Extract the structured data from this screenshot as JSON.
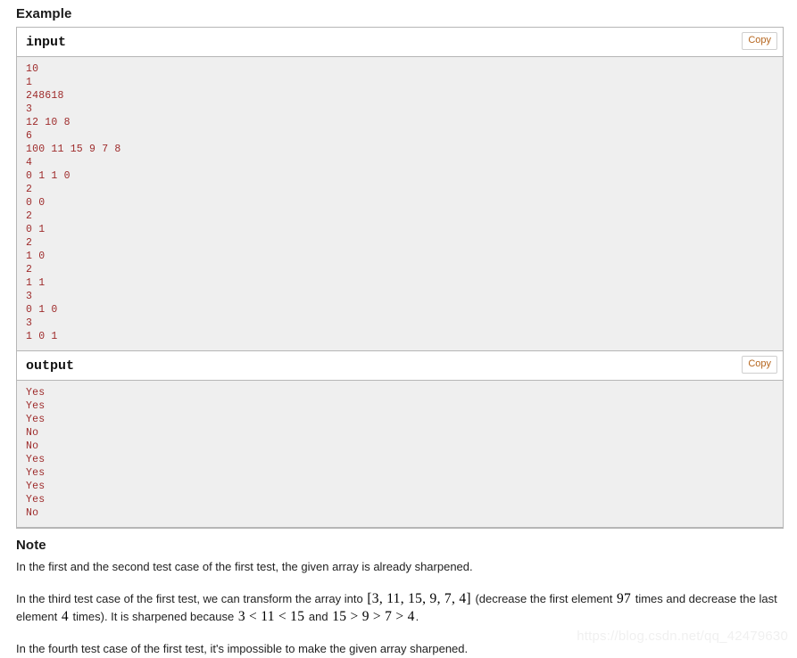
{
  "example": {
    "heading": "Example",
    "blocks": [
      {
        "title": "input",
        "copy_label": "Copy",
        "content": "10\n1\n248618\n3\n12 10 8\n6\n100 11 15 9 7 8\n4\n0 1 1 0\n2\n0 0\n2\n0 1\n2\n1 0\n2\n1 1\n3\n0 1 0\n3\n1 0 1"
      },
      {
        "title": "output",
        "copy_label": "Copy",
        "content": "Yes\nYes\nYes\nNo\nNo\nYes\nYes\nYes\nYes\nNo"
      }
    ]
  },
  "note": {
    "heading": "Note",
    "para1": "In the first and the second test case of the first test, the given array is already sharpened.",
    "para2": {
      "t1": "In the third test case of the first test, we can transform the array into ",
      "m1": "[3, 11, 15, 9, 7, 4]",
      "t2": " (decrease the first element ",
      "m2": "97",
      "t3": " times and decrease the last element ",
      "m3": "4",
      "t4": " times). It is sharpened because ",
      "m4": "3 < 11 < 15",
      "t5": " and ",
      "m5": "15 > 9 > 7 > 4",
      "t6": "."
    },
    "para3": "In the fourth test case of the first test, it's impossible to make the given array sharpened."
  },
  "watermark": "https://blog.csdn.net/qq_42479630",
  "colors": {
    "sample_text": "#9e2b2b",
    "sample_bg": "#efefef",
    "border": "#b6b6b6",
    "copy_text": "#b5651d"
  }
}
